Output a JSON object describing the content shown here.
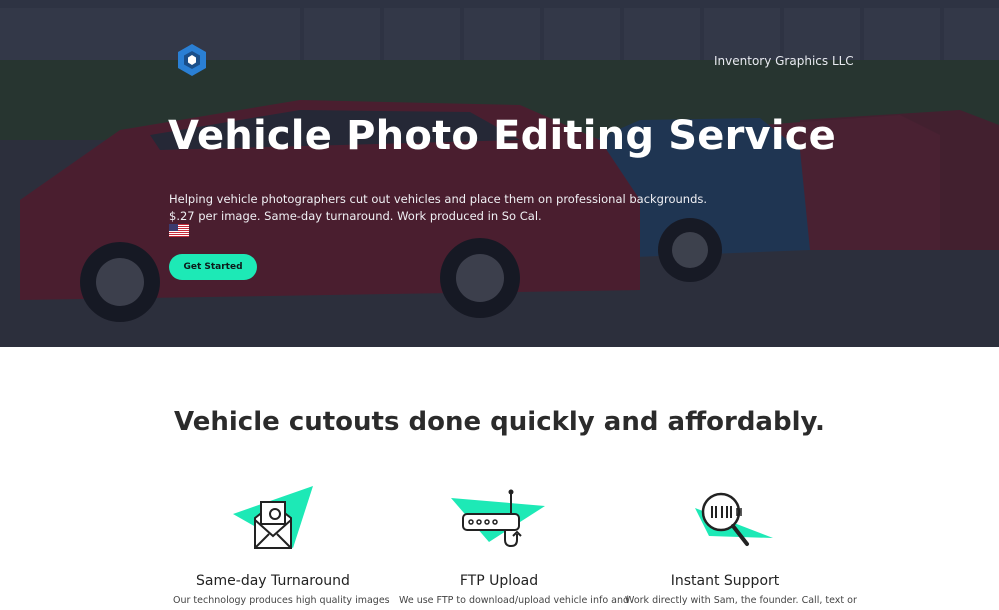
{
  "header": {
    "logo_icon": "hexagon-logo-icon",
    "company_name": "Inventory Graphics LLC"
  },
  "hero": {
    "title": "Vehicle Photo Editing Service",
    "line1": "Helping vehicle photographers cut out vehicles and place them on professional backgrounds.",
    "line2": "$.27 per image. Same-day turnaround. Work produced in So Cal.",
    "flag_icon": "us-flag-icon",
    "cta_label": "Get Started"
  },
  "features_section": {
    "title": "Vehicle cutouts done quickly and affordably.",
    "items": [
      {
        "icon": "photo-envelope-icon",
        "title": "Same-day Turnaround",
        "desc": "Our technology produces high quality images"
      },
      {
        "icon": "router-upload-icon",
        "title": "FTP Upload",
        "desc": "We use FTP to download/upload vehicle info and"
      },
      {
        "icon": "magnifier-support-icon",
        "title": "Instant Support",
        "desc": "Work directly with Sam, the founder. Call, text or"
      }
    ]
  },
  "colors": {
    "accent": "#1de9b6",
    "hero_overlay": "#2a2e3d",
    "logo_blue": "#2a7fd4"
  }
}
